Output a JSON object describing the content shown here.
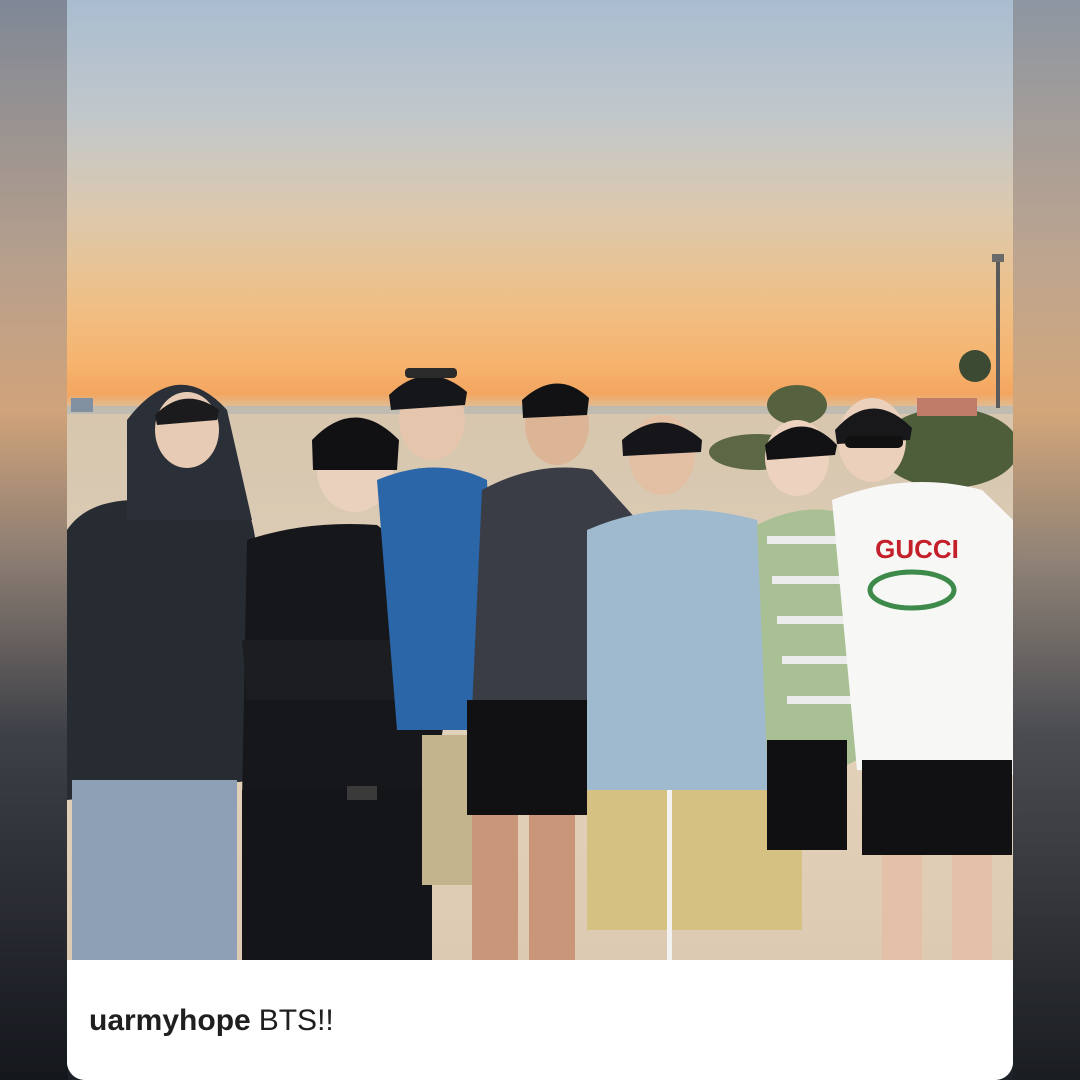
{
  "post": {
    "username": "uarmyhope",
    "caption_text": "BTS!!",
    "photo_icon": "group-photo-image",
    "colors": {
      "caption_bg": "#ffffff",
      "caption_text": "#1f1f1f",
      "sky_top": "#a9bdd0",
      "sunset": "#f3a660",
      "sand": "#ddcab2"
    }
  },
  "photo": {
    "shirt_print": "GUCCI"
  }
}
